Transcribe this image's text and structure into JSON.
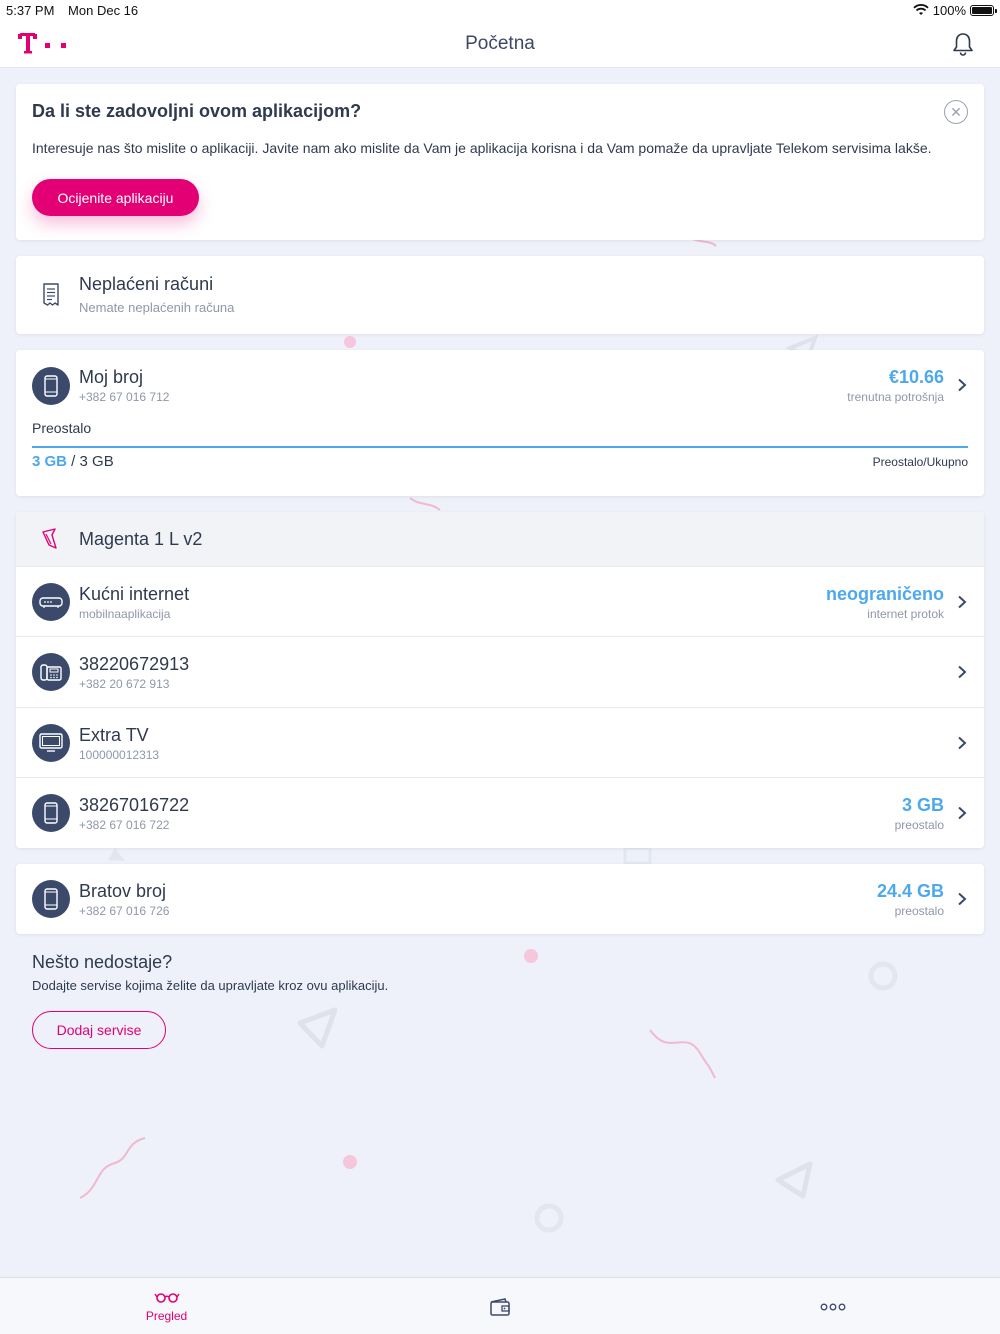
{
  "status_bar": {
    "time": "5:37 PM",
    "date": "Mon Dec 16",
    "battery": "100%"
  },
  "nav": {
    "title": "Početna"
  },
  "rate_card": {
    "title": "Da li ste zadovoljni ovom aplikacijom?",
    "text": "Interesuje nas što mislite o aplikaciji. Javite nam ako mislite da Vam je aplikacija korisna i da Vam pomaže da upravljate Telekom servisima lakše.",
    "button": "Ocijenite aplikaciju"
  },
  "unpaid": {
    "title": "Neplaćeni računi",
    "subtitle": "Nemate neplaćenih računa"
  },
  "my_number": {
    "title": "Moj broj",
    "number": "+382 67 016 712",
    "amount": "€10.66",
    "amount_label": "trenutna potrošnja",
    "remaining_label": "Preostalo",
    "remaining_value": "3 GB",
    "total_value": " / 3 GB",
    "ratio_label": "Preostalo/Ukupno",
    "remaining_fraction": 1.0
  },
  "bundle": {
    "name": "Magenta 1 L v2",
    "services": [
      {
        "title": "Kućni internet",
        "subtitle": "mobilnaaplikacija",
        "value": "neograničeno",
        "value_label": "internet protok"
      },
      {
        "title": "38220672913",
        "subtitle": "+382 20 672 913",
        "value": "",
        "value_label": ""
      },
      {
        "title": "Extra TV",
        "subtitle": "100000012313",
        "value": "",
        "value_label": ""
      },
      {
        "title": "38267016722",
        "subtitle": "+382 67 016 722",
        "value": "3 GB",
        "value_label": "preostalo"
      }
    ]
  },
  "bratov": {
    "title": "Bratov broj",
    "number": "+382 67 016 726",
    "value": "24.4 GB",
    "value_label": "preostalo"
  },
  "missing": {
    "title": "Nešto nedostaje?",
    "text": "Dodajte servise kojima želite da upravljate kroz ovu aplikaciju.",
    "button": "Dodaj servise"
  },
  "tabs": {
    "overview": "Pregled"
  },
  "colors": {
    "magenta": "#e20074",
    "blue": "#4da9ec",
    "navy": "#3b4a6b"
  }
}
